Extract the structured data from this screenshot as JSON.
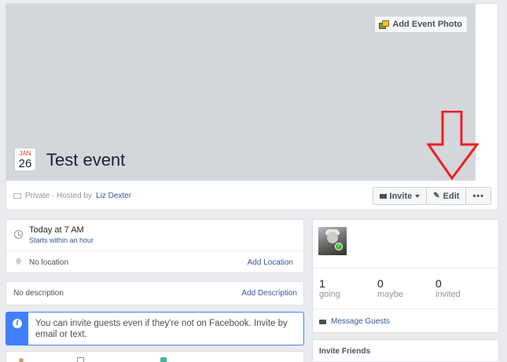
{
  "header": {
    "add_photo_label": "Add Event Photo",
    "date_month": "JAN",
    "date_day": "26",
    "title": "Test event",
    "privacy_text": "Private · Hosted by",
    "host_name": "Liz Dexter",
    "invite_label": "Invite",
    "edit_label": "Edit",
    "more_label": "•••"
  },
  "annotation": {
    "arrow_color": "#e8211f"
  },
  "details": {
    "time": "Today at 7 AM",
    "time_sub": "Starts within an hour",
    "location": "No location",
    "add_location": "Add Location",
    "description": "No description",
    "add_description": "Add Description"
  },
  "info": {
    "icon_glyph": "i",
    "text": "You can invite guests even if they're not on Facebook. Invite by email or text."
  },
  "guests": {
    "stats": [
      {
        "count": "1",
        "label": "going"
      },
      {
        "count": "0",
        "label": "maybe"
      },
      {
        "count": "0",
        "label": "invited"
      }
    ],
    "message_label": "Message Guests",
    "invite_friends_title": "Invite Friends"
  },
  "colors": {
    "link": "#365899",
    "info_blue": "#4080ff",
    "date_red": "#e0392b",
    "check_green": "#42b72a"
  }
}
